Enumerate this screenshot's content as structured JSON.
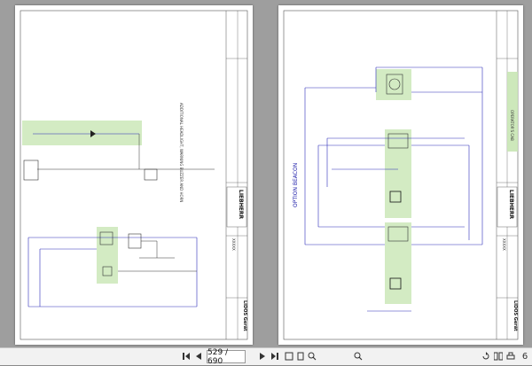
{
  "viewer": {
    "page_current": "529 / 690",
    "zoom_partial": "6"
  },
  "left_sheet": {
    "side_note": "ADDITIONAL HEADLIGHT, WARNING BUZZER AND HORN",
    "logo_text": "LIEBHERR",
    "title_block_line1": "LIDOS Gerät",
    "title_block_line2": "XXXXX"
  },
  "right_sheet": {
    "option_label": "OPTION BEACON",
    "side_note": "OPERATOR'S CAB",
    "logo_text": "LIEBHERR",
    "title_block_line1": "LIDOS Gerät",
    "title_block_line2": "XXXXX"
  },
  "toolbar": {
    "first_icon": "first-page-icon",
    "prev_icon": "prev-page-icon",
    "next_icon": "next-page-icon",
    "last_icon": "last-page-icon"
  }
}
